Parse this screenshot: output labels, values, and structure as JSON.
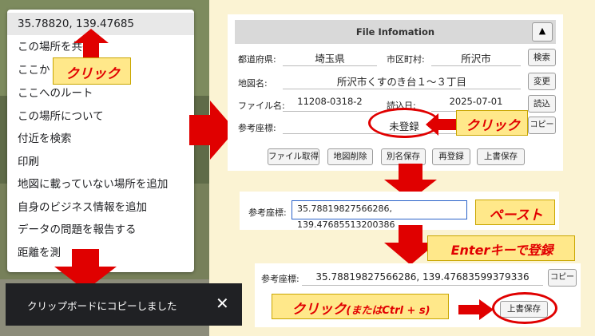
{
  "context_menu": {
    "items": [
      "35.78820, 139.47685",
      "この場所を共有",
      "ここか",
      "ここへのルート",
      "この場所について",
      "付近を検索",
      "印刷",
      "地図に載っていない場所を追加",
      "自身のビジネス情報を追加",
      "データの問題を報告する",
      "距離を測"
    ]
  },
  "callouts": {
    "click1": "クリック",
    "click2": "クリック",
    "paste": "ペースト",
    "enter": "Enterキーで登録",
    "click3_main": "クリック",
    "click3_sub": "(またはCtrl + s)"
  },
  "toast": {
    "text": "クリップボードにコピーしました",
    "close": "✕"
  },
  "file_info": {
    "title": "File Infomation",
    "collapse": "▲",
    "pref_label": "都道府県:",
    "pref_value": "埼玉県",
    "city_label": "市区町村:",
    "city_value": "所沢市",
    "search_btn": "検索",
    "place_label": "地図名:",
    "place_value": "所沢市くすのき台１～３丁目",
    "change_btn": "変更",
    "file_label": "ファイル名:",
    "file_value": "11208-0318-2",
    "read_label": "読込日:",
    "read_value": "2025-07-01",
    "read_btn": "読込",
    "coord_label": "参考座標:",
    "coord_value": "未登録",
    "copy_btn": "コピー",
    "actions": [
      "ファイル取得",
      "地図削除",
      "別名保存",
      "再登録",
      "上書保存"
    ]
  },
  "paste_panel": {
    "label": "参考座標:",
    "value": "35.78819827566286, 139.47685513200386"
  },
  "final_panel": {
    "label": "参考座標:",
    "value": "35.78819827566286, 139.47683599379336",
    "copy_btn": "コピー",
    "save_btn": "上書保存"
  }
}
